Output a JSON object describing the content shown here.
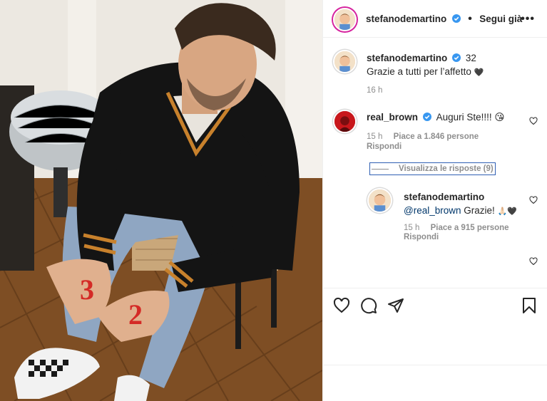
{
  "post": {
    "author": "stefanodemartino",
    "header_follow_label": "Segui già",
    "header_more_label": "•••"
  },
  "caption": {
    "author": "stefanodemartino",
    "title_text": "32",
    "body_text": "Grazie a tutti per l’affetto",
    "heart_glyph": "🖤",
    "time": "16 h"
  },
  "comments": [
    {
      "author": "real_brown",
      "text": "Auguri Ste!!!!",
      "emoji": "😘",
      "time": "15 h",
      "likes": "Piace a 1.846 persone",
      "reply_label": "Rispondi"
    }
  ],
  "view_replies_label": "Visualizza le risposte (9)",
  "reply": {
    "author": "stefanodemartino",
    "mention": "@real_brown",
    "text": "Grazie!",
    "emoji": "🙏🏻🖤",
    "time": "15 h",
    "likes": "Piace a 915 persone",
    "reply_label": "Rispondi"
  },
  "icons": {
    "verified": "verified-badge-icon",
    "like": "heart-icon",
    "comment": "comment-icon",
    "share": "share-icon",
    "save": "bookmark-icon"
  },
  "colors": {
    "verified_blue": "#3897f0",
    "text": "#262626",
    "secondary": "#8e8e8e"
  }
}
